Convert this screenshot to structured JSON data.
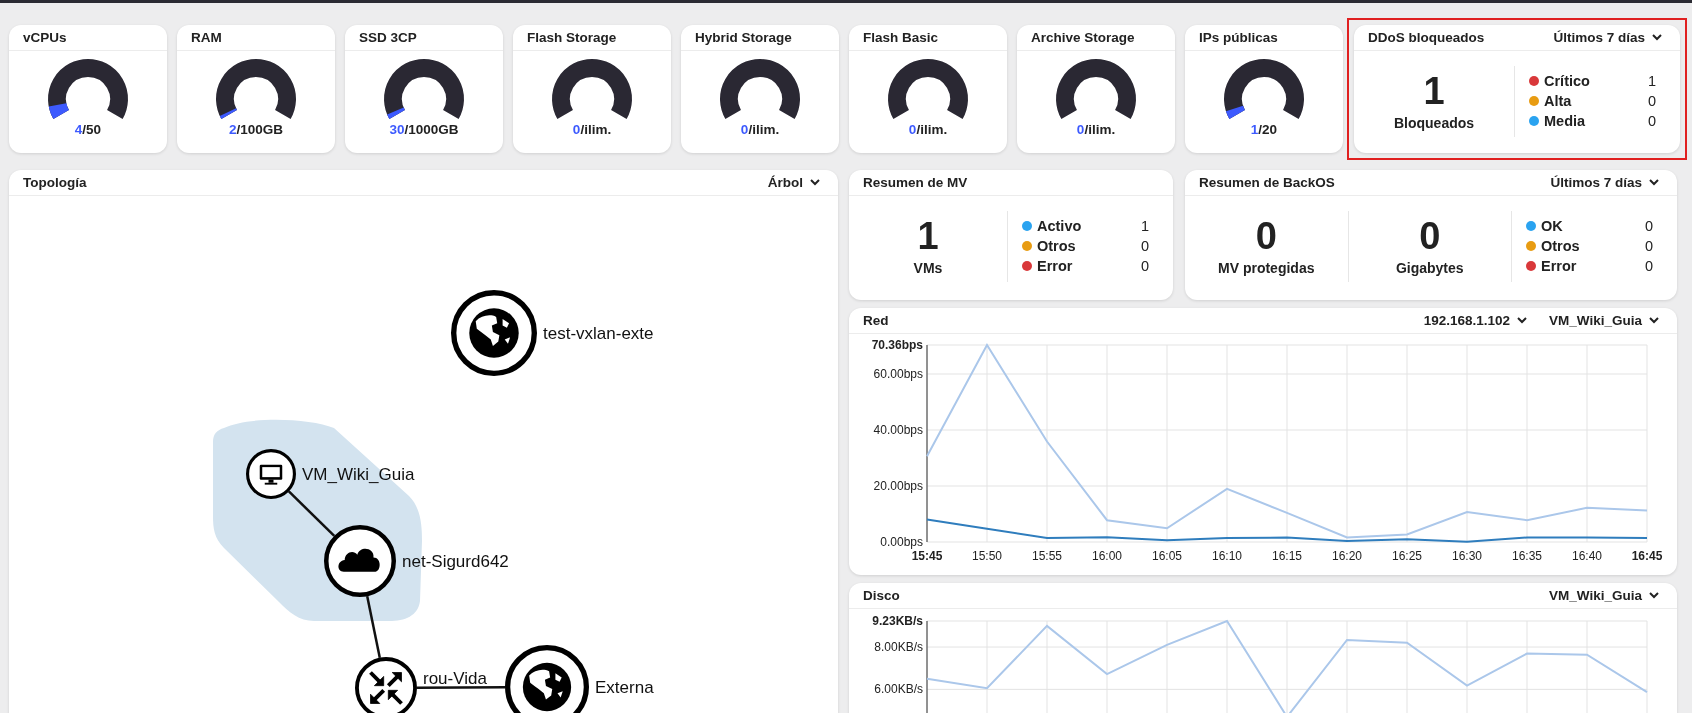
{
  "gauges": [
    {
      "title": "vCPUs",
      "used": "4",
      "total": "/50",
      "level": 0.08
    },
    {
      "title": "RAM",
      "used": "2",
      "total": "/100GB",
      "level": 0.02
    },
    {
      "title": "SSD 3CP",
      "used": "30",
      "total": "/1000GB",
      "level": 0.03
    },
    {
      "title": "Flash Storage",
      "used": "0",
      "total": "/ilim."
    },
    {
      "title": "Hybrid Storage",
      "used": "0",
      "total": "/ilim."
    },
    {
      "title": "Flash Basic",
      "used": "0",
      "total": "/ilim."
    },
    {
      "title": "Archive Storage",
      "used": "0",
      "total": "/ilim."
    },
    {
      "title": "IPs públicas",
      "used": "1",
      "total": "/20",
      "level": 0.05
    }
  ],
  "ddos": {
    "title": "DDoS bloqueados",
    "period": "Últimos 7 días",
    "highlighted": true,
    "stats": [
      {
        "value": "1",
        "label": "Bloqueados"
      }
    ],
    "legend": [
      {
        "label": "Crítico",
        "count": "1",
        "color": "#d9383a"
      },
      {
        "label": "Alta",
        "count": "0",
        "color": "#e89c12"
      },
      {
        "label": "Media",
        "count": "0",
        "color": "#2aa3f0"
      }
    ]
  },
  "topology": {
    "title": "Topología",
    "view": "Árbol",
    "nodes": [
      {
        "kind": "globe",
        "label": "test-vxlan-exte"
      },
      {
        "kind": "vm",
        "label": "VM_Wiki_Guia"
      },
      {
        "kind": "network",
        "label": "net-Sigurd642"
      },
      {
        "kind": "router",
        "label": "rou-Vida"
      },
      {
        "kind": "globe",
        "label": "Externa"
      }
    ]
  },
  "mv_summary": {
    "title": "Resumen de MV",
    "stats": [
      {
        "value": "1",
        "label": "VMs"
      }
    ],
    "legend": [
      {
        "label": "Activo",
        "count": "1",
        "color": "#2aa3f0"
      },
      {
        "label": "Otros",
        "count": "0",
        "color": "#e89c12"
      },
      {
        "label": "Error",
        "count": "0",
        "color": "#d9383a"
      }
    ]
  },
  "backos": {
    "title": "Resumen de BackOS",
    "period": "Últimos 7 días",
    "stats": [
      {
        "value": "0",
        "label": "MV protegidas"
      },
      {
        "value": "0",
        "label": "Gigabytes"
      }
    ],
    "legend": [
      {
        "label": "OK",
        "count": "0",
        "color": "#2aa3f0"
      },
      {
        "label": "Otros",
        "count": "0",
        "color": "#e89c12"
      },
      {
        "label": "Error",
        "count": "0",
        "color": "#d9383a"
      }
    ]
  },
  "red": {
    "title": "Red",
    "filters": [
      "192.168.1.102",
      "VM_Wiki_Guia"
    ],
    "chart_data": {
      "type": "line",
      "grid": true,
      "categories": [
        "15:45",
        "15:50",
        "15:55",
        "16:00",
        "16:05",
        "16:10",
        "16:15",
        "16:20",
        "16:25",
        "16:30",
        "16:35",
        "16:40",
        "16:45"
      ],
      "series": [
        {
          "color": "#abc7ea",
          "values": [
            30.6,
            70.36,
            35.9,
            7.8,
            4.9,
            19,
            10.4,
            1.6,
            2.7,
            10.7,
            7.8,
            12.2,
            11.3
          ]
        },
        {
          "color": "#2f7dbd",
          "values": [
            8,
            4.7,
            1.4,
            1.7,
            0.6,
            1.4,
            1.6,
            0.4,
            1,
            0.1,
            1.6,
            1.6,
            1.4
          ]
        }
      ],
      "ylim": [
        0,
        70.36
      ],
      "yticks": [
        {
          "value": 0,
          "label": "0.00bps"
        },
        {
          "value": 20,
          "label": "20.00bps"
        },
        {
          "value": 40,
          "label": "40.00bps"
        },
        {
          "value": 60,
          "label": "60.00bps"
        },
        {
          "value": 70.36,
          "label": "70.36bps"
        }
      ]
    }
  },
  "disco": {
    "title": "Disco",
    "filters": [
      "VM_Wiki_Guia"
    ],
    "chart_data": {
      "type": "line",
      "grid": true,
      "series": [
        {
          "color": "#abc7ea",
          "values": [
            6.5,
            6.05,
            9,
            6.72,
            8.1,
            9.23,
            4.7,
            8.33,
            8.2,
            6.18,
            7.69,
            7.64,
            5.87
          ]
        }
      ],
      "ylim": [
        4.6,
        9.23
      ],
      "yticks": [
        {
          "value": 6,
          "label": "6.00KB/s"
        },
        {
          "value": 8,
          "label": "8.00KB/s"
        },
        {
          "value": 9.23,
          "label": "9.23KB/s"
        }
      ]
    }
  }
}
